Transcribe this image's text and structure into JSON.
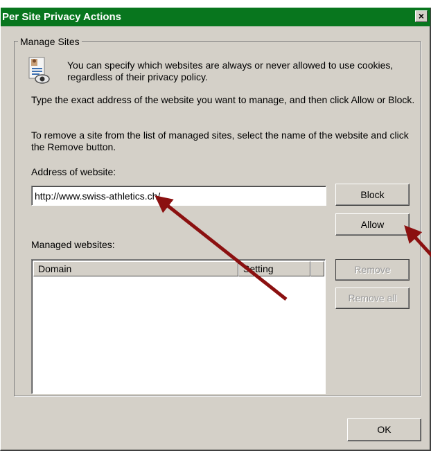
{
  "window": {
    "title": "Per Site Privacy Actions",
    "close_glyph": "×",
    "title_bar_color": "#08761e"
  },
  "manage_sites": {
    "group_label": "Manage Sites",
    "info_icon": "privacy-eye-document-icon",
    "info_text": "You can specify which websites are always or never allowed to use cookies, regardless of their privacy policy.",
    "instruction_1": "Type the exact address of the website you want to manage, and then click Allow or Block.",
    "instruction_2": "To remove a site from the list of managed sites, select the name of the website and click the Remove button.",
    "address_label": "Address of website:",
    "address_value": "http://www.swiss-athletics.ch/",
    "block_label": "Block",
    "allow_label": "Allow",
    "managed_label": "Managed websites:",
    "columns": [
      "Domain",
      "Setting"
    ],
    "rows": [],
    "remove_label": "Remove",
    "remove_all_label": "Remove all"
  },
  "footer": {
    "ok_label": "OK"
  },
  "annotations": {
    "arrow_color": "#8b1010"
  }
}
